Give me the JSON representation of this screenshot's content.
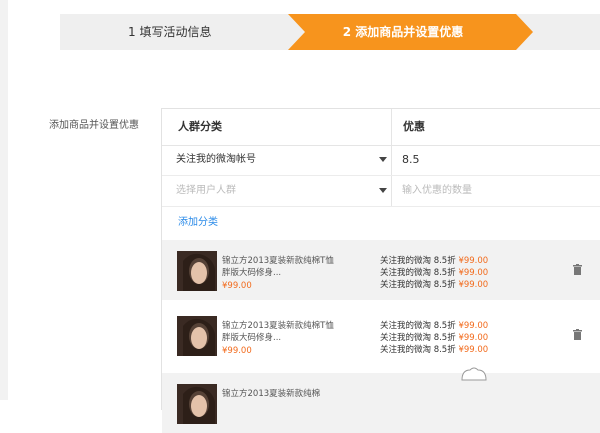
{
  "steps": {
    "step1": "1  填写活动信息",
    "step2": "2  添加商品并设置优惠"
  },
  "section_label": "添加商品并设置优惠",
  "table": {
    "headers": {
      "group": "人群分类",
      "discount": "优惠"
    },
    "rows": [
      {
        "group": "关注我的微淘帐号",
        "value": "8.5"
      },
      {
        "group": "选择用户人群",
        "value": "输入优惠的数量"
      }
    ],
    "add_category": "添加分类"
  },
  "products": [
    {
      "title": "锦立方2013夏装新款纯棉T恤 胖版大码修身...",
      "price": "¥99.00",
      "rules": [
        {
          "text": "关注我的微淘 8.5折",
          "price": "¥99.00"
        },
        {
          "text": "关注我的微淘 8.5折",
          "price": "¥99.00"
        },
        {
          "text": "关注我的微淘 8.5折",
          "price": "¥99.00"
        }
      ]
    },
    {
      "title": "锦立方2013夏装新款纯棉T恤 胖版大码修身...",
      "price": "¥99.00",
      "rules": [
        {
          "text": "关注我的微淘 8.5折",
          "price": "¥99.00"
        },
        {
          "text": "关注我的微淘 8.5折",
          "price": "¥99.00"
        },
        {
          "text": "关注我的微淘 8.5折",
          "price": "¥99.00"
        }
      ]
    },
    {
      "title": "锦立方2013夏装新款纯棉",
      "price": "",
      "rules": [
        {
          "text": "",
          "price": ""
        }
      ]
    }
  ],
  "colors": {
    "accent": "#f7941d",
    "link": "#2a8ae8",
    "price": "#f26b1d"
  }
}
